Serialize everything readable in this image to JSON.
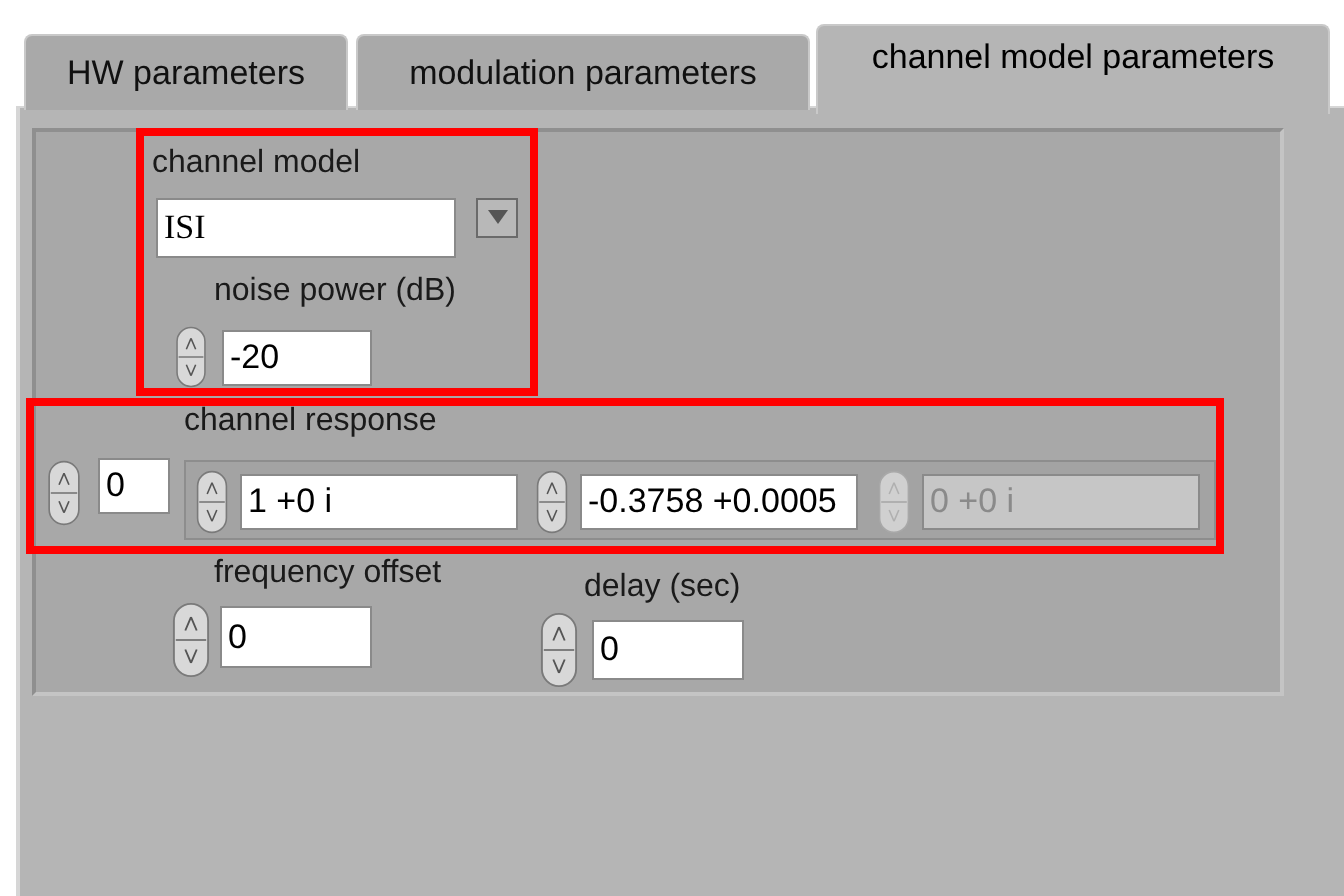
{
  "tabs": [
    {
      "label": "HW parameters",
      "selected": false
    },
    {
      "label": "modulation parameters",
      "selected": false
    },
    {
      "label": "channel model parameters",
      "selected": true
    }
  ],
  "channel_model": {
    "label": "channel model",
    "value": "ISI"
  },
  "noise_power": {
    "label": "noise power (dB)",
    "value": "-20"
  },
  "channel_response": {
    "label": "channel response",
    "index": "0",
    "elements": [
      {
        "value": "1 +0 i",
        "disabled": false
      },
      {
        "value": "-0.3758 +0.0005",
        "disabled": false
      },
      {
        "value": "0 +0 i",
        "disabled": true
      }
    ]
  },
  "frequency_offset": {
    "label": "frequency offset",
    "value": "0"
  },
  "delay": {
    "label": "delay (sec)",
    "value": "0"
  }
}
